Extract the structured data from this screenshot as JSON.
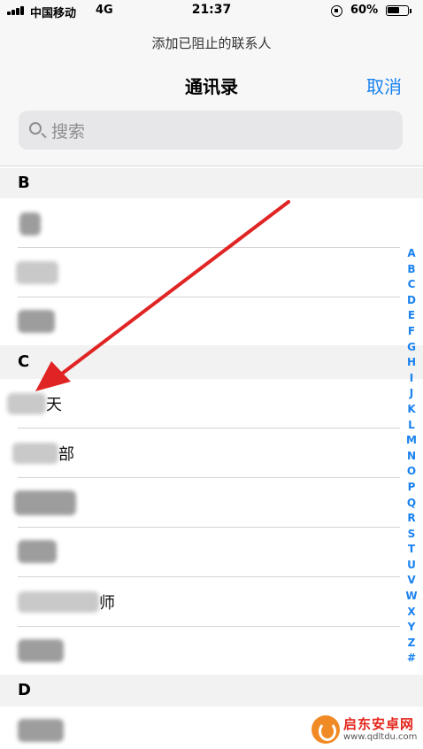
{
  "status_bar": {
    "carrier": "中国移动",
    "network": "4G",
    "time": "21:37",
    "battery_percent": "60%",
    "battery_level": 0.6
  },
  "header": {
    "prompt": "添加已阻止的联系人",
    "title": "通讯录",
    "cancel_label": "取消"
  },
  "search": {
    "placeholder": "搜索"
  },
  "sections": {
    "b": {
      "letter": "B"
    },
    "c": {
      "letter": "C"
    },
    "d": {
      "letter": "D"
    }
  },
  "rows": {
    "b1": "",
    "b2": "",
    "b3": "",
    "c1": "天",
    "c2": "部",
    "c3": "",
    "c4": "",
    "c5": "师",
    "c6": "",
    "d1": ""
  },
  "index_letters": [
    "A",
    "B",
    "C",
    "D",
    "E",
    "F",
    "G",
    "H",
    "I",
    "J",
    "K",
    "L",
    "M",
    "N",
    "O",
    "P",
    "Q",
    "R",
    "S",
    "T",
    "U",
    "V",
    "W",
    "X",
    "Y",
    "Z",
    "#"
  ],
  "watermark": {
    "name": "启东安卓网",
    "url": "www.qdltdu.com"
  },
  "colors": {
    "accent": "#1a82f0",
    "annotation_arrow": "#e02424"
  }
}
